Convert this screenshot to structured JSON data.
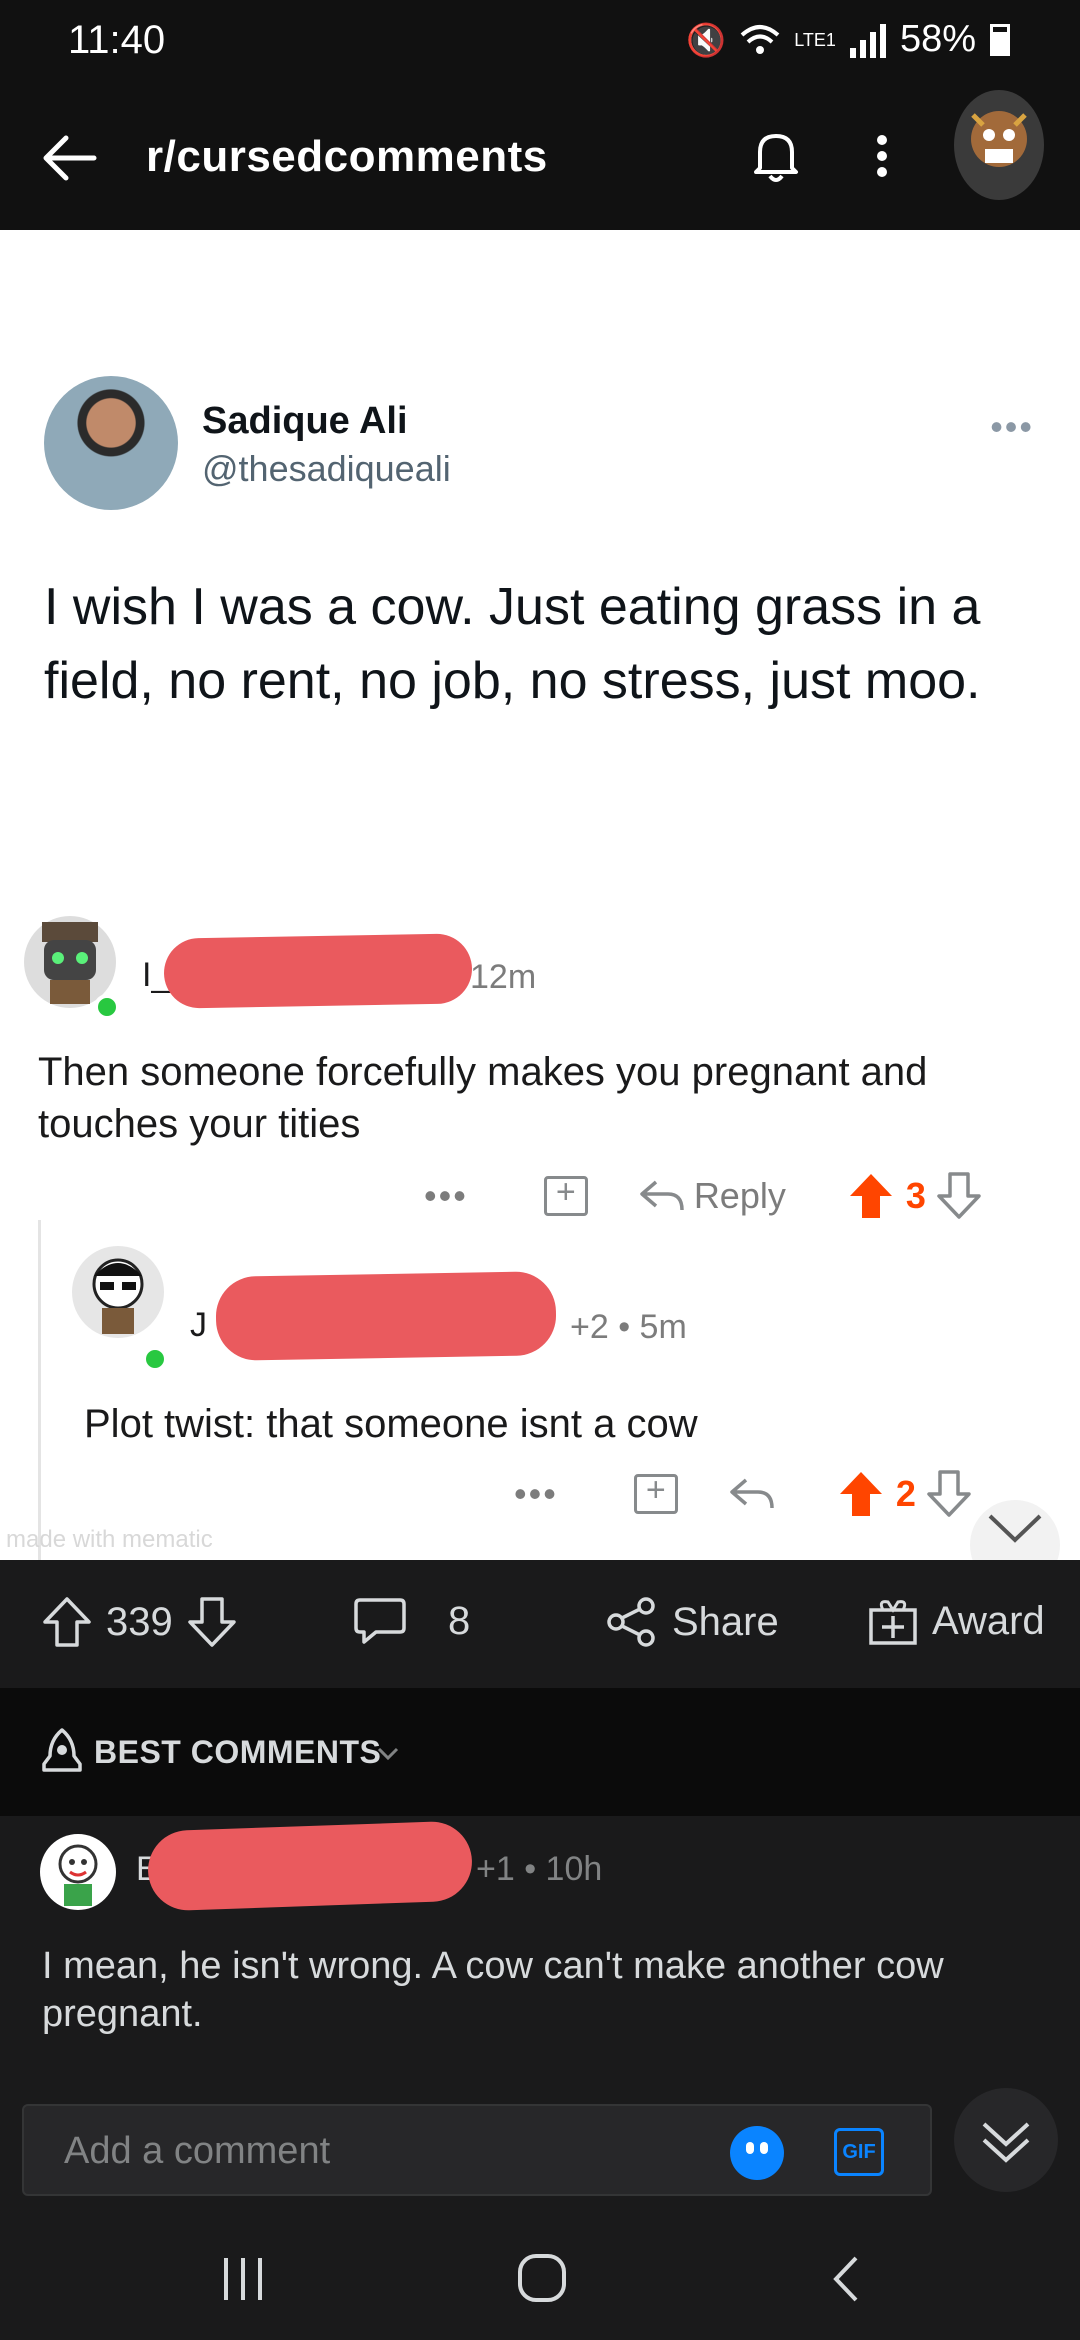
{
  "status_bar": {
    "time": "11:40",
    "network": "LTE1",
    "battery": "58%"
  },
  "app_bar": {
    "title": "r/cursedcomments"
  },
  "post_image": {
    "tweet": {
      "name": "Sadique Ali",
      "handle": "@thesadiqueali",
      "text": "I wish I was a cow. Just eating grass in a field, no rent, no job, no stress, just moo."
    },
    "comment1": {
      "user_initial": "I_",
      "time": "12m",
      "text": "Then someone forcefully makes you pregnant and touches your tities",
      "reply_label": "Reply",
      "score": "3"
    },
    "comment2": {
      "user_initial": "J",
      "meta": "+2 • 5m",
      "text": "Plot twist: that someone isnt a cow",
      "score": "2"
    },
    "watermark": "made with mematic"
  },
  "post_actions": {
    "votes": "339",
    "comments": "8",
    "share": "Share",
    "award": "Award"
  },
  "sort": {
    "label": "BEST COMMENTS"
  },
  "comment": {
    "user_initial": "E",
    "meta": "+1 • 10h",
    "text": "I mean, he isn't wrong. A cow can't make another cow pregnant."
  },
  "composer": {
    "placeholder": "Add a comment",
    "gif_label": "GIF"
  },
  "colors": {
    "upvote": "#ff4500",
    "redaction": "#ea5a5e",
    "accent": "#0a84ff"
  }
}
